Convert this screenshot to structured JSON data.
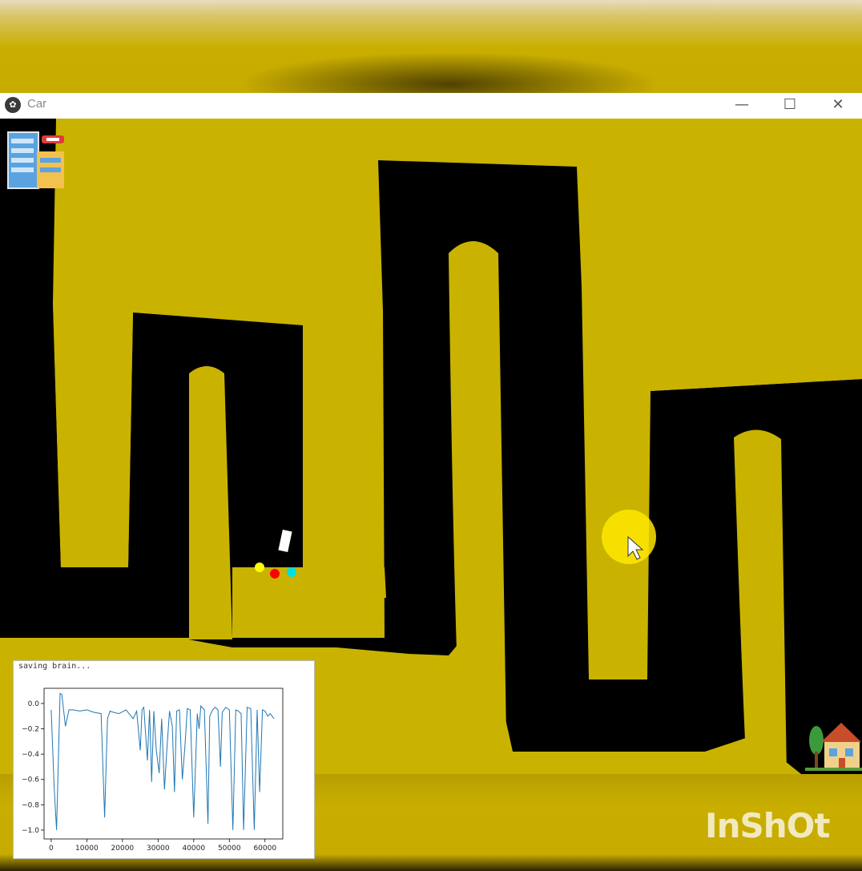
{
  "window": {
    "title": "Car",
    "app_icon": "kivy-logo-icon",
    "controls": {
      "minimize": "—",
      "maximize": "☐",
      "close": "✕"
    }
  },
  "map": {
    "sand_color": "#c9b300",
    "road_color": "#000000",
    "start_icon": "office-building-icon",
    "goal_icon": "house-icon",
    "car_color": "#ffffff",
    "sensors": [
      {
        "name": "left-sensor",
        "color": "#ffff00"
      },
      {
        "name": "center-sensor",
        "color": "#ff0000"
      },
      {
        "name": "right-sensor",
        "color": "#00e0e0"
      }
    ],
    "cursor_icon": "mouse-pointer-icon"
  },
  "plot": {
    "status_text": "saving brain...",
    "chart_data": {
      "type": "line",
      "series": [
        {
          "color": "#1f77b4",
          "x": [
            0,
            800,
            1500,
            2500,
            3000,
            4000,
            5000,
            6000,
            8000,
            10000,
            12000,
            14000,
            15000,
            15800,
            16500,
            17500,
            19000,
            21000,
            23000,
            24000,
            25000,
            25500,
            26000,
            27000,
            27600,
            28200,
            28800,
            29500,
            30300,
            31000,
            31800,
            32500,
            33200,
            34000,
            34600,
            35200,
            36000,
            36800,
            37500,
            38200,
            39000,
            40000,
            41000,
            41500,
            42000,
            43000,
            44000,
            44500,
            45300,
            46000,
            46800,
            47500,
            48000,
            49000,
            50000,
            51000,
            51800,
            52500,
            53300,
            54000,
            55000,
            56000,
            57000,
            57800,
            58500,
            59300,
            60000,
            60800,
            61500,
            62500
          ],
          "values": [
            -0.05,
            -0.65,
            -1.0,
            0.08,
            0.07,
            -0.18,
            -0.05,
            -0.05,
            -0.06,
            -0.05,
            -0.07,
            -0.08,
            -0.9,
            -0.12,
            -0.06,
            -0.07,
            -0.08,
            -0.05,
            -0.12,
            -0.06,
            -0.37,
            -0.05,
            -0.03,
            -0.45,
            -0.05,
            -0.62,
            -0.06,
            -0.37,
            -0.55,
            -0.12,
            -0.68,
            -0.35,
            -0.06,
            -0.18,
            -0.7,
            -0.06,
            -0.05,
            -0.6,
            -0.35,
            -0.04,
            -0.05,
            -0.9,
            -0.08,
            -0.2,
            -0.02,
            -0.05,
            -0.95,
            -0.1,
            -0.05,
            -0.03,
            -0.05,
            -0.5,
            -0.07,
            -0.03,
            -0.05,
            -1.0,
            -0.05,
            -0.06,
            -0.08,
            -1.0,
            -0.03,
            -0.04,
            -1.0,
            -0.05,
            -0.7,
            -0.05,
            -0.06,
            -0.1,
            -0.08,
            -0.12
          ]
        }
      ],
      "xlim": [
        -2000,
        65000
      ],
      "ylim": [
        -1.07,
        0.12
      ],
      "xticks": [
        0,
        10000,
        20000,
        30000,
        40000,
        50000,
        60000
      ],
      "xtick_labels": [
        "0",
        "10000",
        "20000",
        "30000",
        "40000",
        "50000",
        "60000"
      ],
      "yticks": [
        0.0,
        -0.2,
        -0.4,
        -0.6,
        -0.8,
        -1.0
      ],
      "ytick_labels": [
        "0.0",
        "−0.2",
        "−0.4",
        "−0.6",
        "−0.8",
        "−1.0"
      ],
      "grid": false
    }
  },
  "watermark": "InShOt"
}
